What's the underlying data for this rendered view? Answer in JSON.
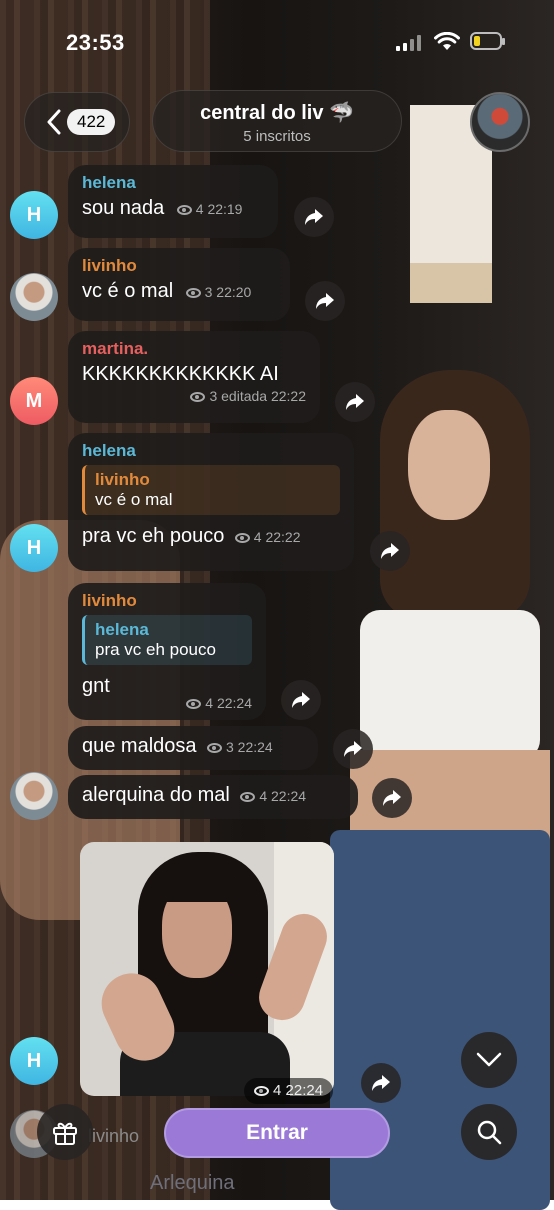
{
  "status_bar": {
    "time": "23:53"
  },
  "header": {
    "back_count": "422",
    "channel_title": "central do liv 🦈",
    "subscribers": "5 inscritos"
  },
  "messages": [
    {
      "avatar_letter": "H",
      "text": "sou nada",
      "views": "4",
      "time": "22:19",
      "sender": "helena"
    },
    {
      "sender": "livinho",
      "text": "vc é o mal",
      "views": "3",
      "time": "22:20"
    },
    {
      "sender": "martina.",
      "avatar_letter": "M",
      "text": "KKKKKKKKKKKKK AI",
      "views": "3",
      "time": "editada 22:22"
    },
    {
      "sender": "helena",
      "avatar_letter": "H",
      "reply_to": {
        "name": "livinho",
        "text": "vc é o mal"
      },
      "text": "pra vc eh pouco",
      "views": "4",
      "time": "22:22"
    },
    {
      "sender": "livinho",
      "reply_to": {
        "name": "helena",
        "text": "pra vc eh pouco"
      },
      "text": "gnt",
      "views": "4",
      "time": "22:24"
    },
    {
      "text": "que maldosa",
      "views": "3",
      "time": "22:24"
    },
    {
      "text": "alerquina do mal",
      "views": "4",
      "time": "22:24"
    },
    {
      "avatar_letter": "H",
      "media": "video",
      "views": "4",
      "time": "22:24"
    }
  ],
  "bottom": {
    "join_label": "Entrar",
    "partial_sender": "livinho",
    "partial_text": "Arlequina"
  },
  "colors": {
    "helena": "#5bb8d6",
    "livinho": "#e28a3c",
    "martina": "#e5605e",
    "join_button": "#9a7ad6",
    "reply_bar_livinho": "#e28a3c",
    "reply_bar_helena": "#5bb8d6"
  },
  "icons": [
    "back-chevron-icon",
    "signal-icon",
    "wifi-icon",
    "battery-icon",
    "eye-icon",
    "share-arrow-icon",
    "gift-icon",
    "chevron-down-icon",
    "search-icon"
  ]
}
